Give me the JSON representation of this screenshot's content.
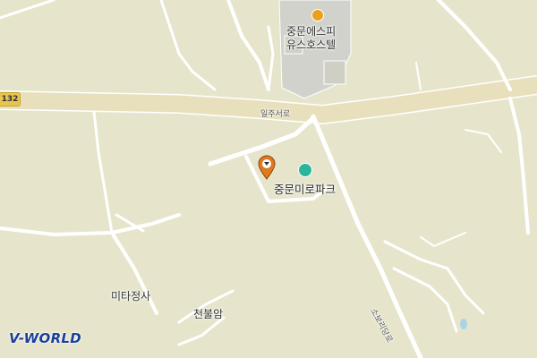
{
  "map": {
    "route_number": "132",
    "road_ilju": "일주서로",
    "road_sopaeki": "소보리당로",
    "poi_jungmun_miro_park": "중문미로파크",
    "poi_youth_hostel_line1": "중문에스피",
    "poi_youth_hostel_line2": "유스호스텔",
    "poi_mitajeongsa": "미타정사",
    "poi_cheonburam": "천불암",
    "logo_text": "V-WORLD",
    "colors": {
      "background": "#e6e5cc",
      "road": "#ffffff",
      "highway": "#e6dcb4",
      "park_icon": "#2bb59a",
      "pin": "#e07a1f",
      "hotel_icon": "#e8a21a",
      "logo": "#1a3f9a"
    },
    "icons": [
      "location-pin-icon",
      "park-icon",
      "hotel-icon"
    ]
  }
}
